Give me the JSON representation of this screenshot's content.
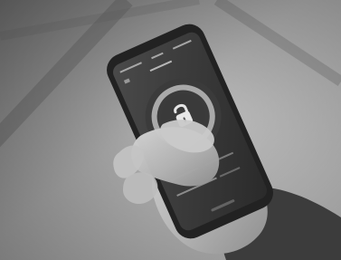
{
  "photo": {
    "description_visible_text": {
      "status_left": "",
      "status_time": "",
      "status_right": "",
      "app_title": "",
      "row1_label": "",
      "row2_label": ""
    },
    "colors": {
      "background_light": "#bdbdbd",
      "background_dark": "#6f6f6f",
      "phone_body": "#2a2a2a",
      "phone_screen": "#3a3a3a",
      "ring": "#9a9a9a",
      "hand_skin": "#b8b8b8",
      "sleeve": "#3b3b3b"
    },
    "icons": {
      "center_icon": "lock-icon"
    }
  }
}
